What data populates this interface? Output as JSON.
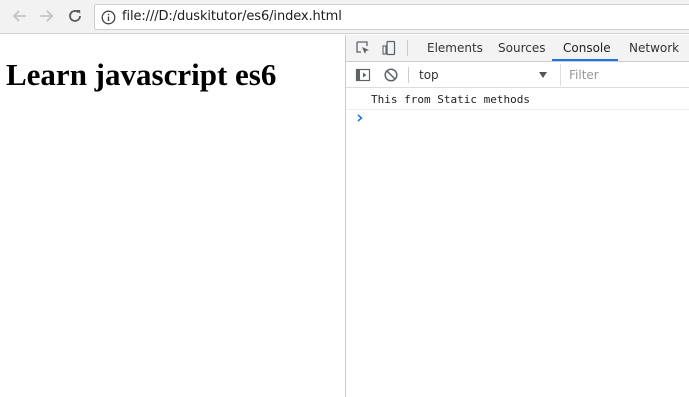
{
  "browser": {
    "url": "file:///D:/duskitutor/es6/index.html",
    "icons": {
      "back": "arrow-left-icon",
      "forward": "arrow-right-icon",
      "reload": "reload-icon",
      "info": "info-icon"
    }
  },
  "page": {
    "heading": "Learn javascript es6"
  },
  "devtools": {
    "tabs": [
      {
        "label": "Elements",
        "active": false
      },
      {
        "label": "Sources",
        "active": false
      },
      {
        "label": "Console",
        "active": true
      },
      {
        "label": "Network",
        "active": false
      }
    ],
    "toolbar_icons": [
      "inspect-element-icon",
      "device-toggle-icon"
    ],
    "console_toolbar_icons": [
      "show-sidebar-icon",
      "clear-console-icon"
    ],
    "context": "top",
    "filter_placeholder": "Filter",
    "messages": [
      {
        "text": "This from Static methods"
      }
    ],
    "accent_color": "#1a73e8"
  }
}
